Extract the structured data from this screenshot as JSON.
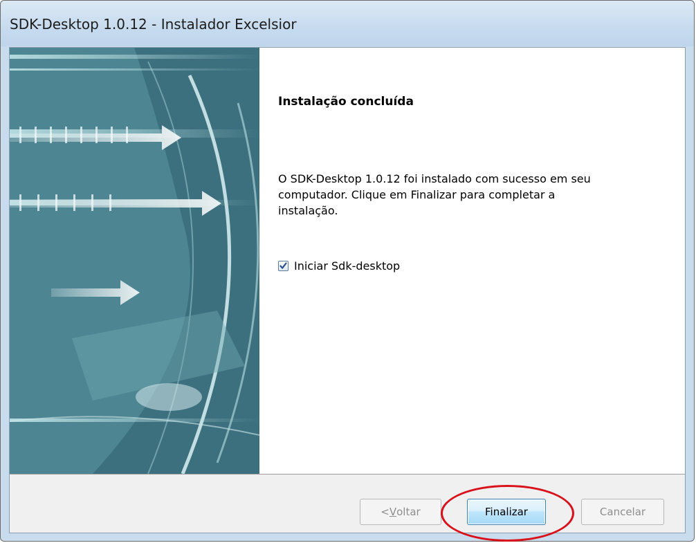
{
  "window": {
    "title": "SDK-Desktop 1.0.12 - Instalador Excelsior"
  },
  "content": {
    "heading": "Instalação concluída",
    "body_line1": "O SDK-Desktop 1.0.12 foi instalado com sucesso em seu",
    "body_line2": "computador. Clique em Finalizar para completar a",
    "body_line3": "instalação.",
    "launch_checkbox": {
      "label": "Iniciar Sdk-desktop",
      "checked": true
    }
  },
  "footer": {
    "back_prefix": "< ",
    "back_accel": "V",
    "back_rest": "oltar",
    "finish_label": "Finalizar",
    "cancel_label": "Cancelar"
  },
  "colors": {
    "titlebar": "#c9dced",
    "annotation": "#d8111a",
    "finish_border": "#3c7fb1"
  }
}
